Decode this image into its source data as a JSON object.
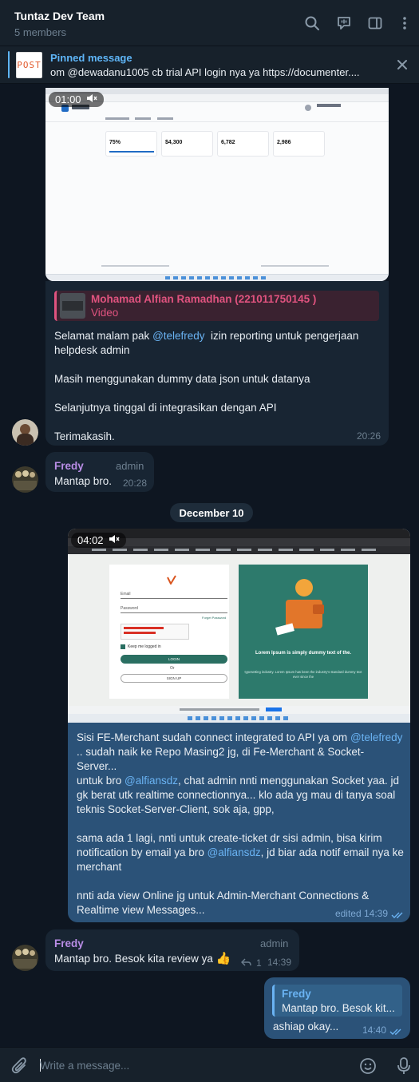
{
  "header": {
    "title": "Tuntaz Dev Team",
    "subtitle": "5 members"
  },
  "pinned": {
    "thumb_text": "POST",
    "title": "Pinned message",
    "text": "om @dewadanu1005 cb trial API login nya ya  https://documenter...."
  },
  "messages": {
    "video1": {
      "duration": "01:00"
    },
    "alfian": {
      "reply_name": "Mohamad Alfian Ramadhan (221011750145 )",
      "reply_type": "Video",
      "text_pre": "Selamat malam pak ",
      "mention": "@telefredy",
      "text_post": "  izin reporting untuk pengerjaan helpdesk admin",
      "p2": "Masih menggunakan dummy data json untuk datanya",
      "p3": "Selanjutnya tinggal di integrasikan dengan API",
      "p4": "Terimakasih.",
      "time": "20:26"
    },
    "fredy1": {
      "sender": "Fredy",
      "role": "admin",
      "text": "Mantap bro.",
      "time": "20:28"
    },
    "date_divider": "December 10",
    "video2": {
      "duration": "04:02",
      "login_form": {
        "email_label": "Email",
        "password_label": "Password",
        "forgot": "Forget Password",
        "remember": "Keep me logged in",
        "login_btn": "LOGIN",
        "or": "Or",
        "signup_btn": "SIGN UP",
        "panel_title": "Lorem Ipsum is simply dummy text of the.",
        "panel_text": "typesetting industry. Lorem Ipsum has been the industry's standard dummy text ever since the"
      }
    },
    "out1": {
      "l1_pre": "Sisi FE-Merchant sudah connect integrated to API ya om ",
      "l1_mention": "@telefredy",
      "l1_post": " .. sudah naik ke Repo Masing2 jg, di Fe-Merchant & Socket-Server...",
      "p2_pre": "untuk bro ",
      "p2_mention": "@alfiansdz",
      "p2_post": ", chat admin nnti menggunakan Socket yaa. jd gk berat utk realtime connectionnya... klo ada yg mau di tanya soal teknis Socket-Server-Client, sok aja, gpp,",
      "p3_pre": "sama ada 1 lagi, nnti untuk create-ticket dr sisi admin, bisa kirim notification by email ya bro ",
      "p3_mention": "@alfiansdz",
      "p3_post": ", jd biar ada notif email nya ke merchant",
      "p4": "nnti ada view Online jg untuk Admin-Merchant Connections & Realtime view Messages...",
      "time": "edited 14:39"
    },
    "fredy2": {
      "sender": "Fredy",
      "role": "admin",
      "text": "Mantap bro. Besok kita review ya",
      "emoji": "👍",
      "reply_count": "1",
      "time": "14:39"
    },
    "out2": {
      "reply_name": "Fredy",
      "reply_text": "Mantap bro. Besok kit...",
      "text": "ashiap okay...",
      "time": "14:40"
    }
  },
  "composer": {
    "placeholder": "Write a message..."
  },
  "colors": {
    "background": "#0e1621",
    "panel": "#17212b",
    "incoming": "#182533",
    "outgoing": "#2b5278",
    "accent": "#5eb5f7",
    "sender_fredy": "#b98de6",
    "sender_alfian": "#e0537f"
  }
}
